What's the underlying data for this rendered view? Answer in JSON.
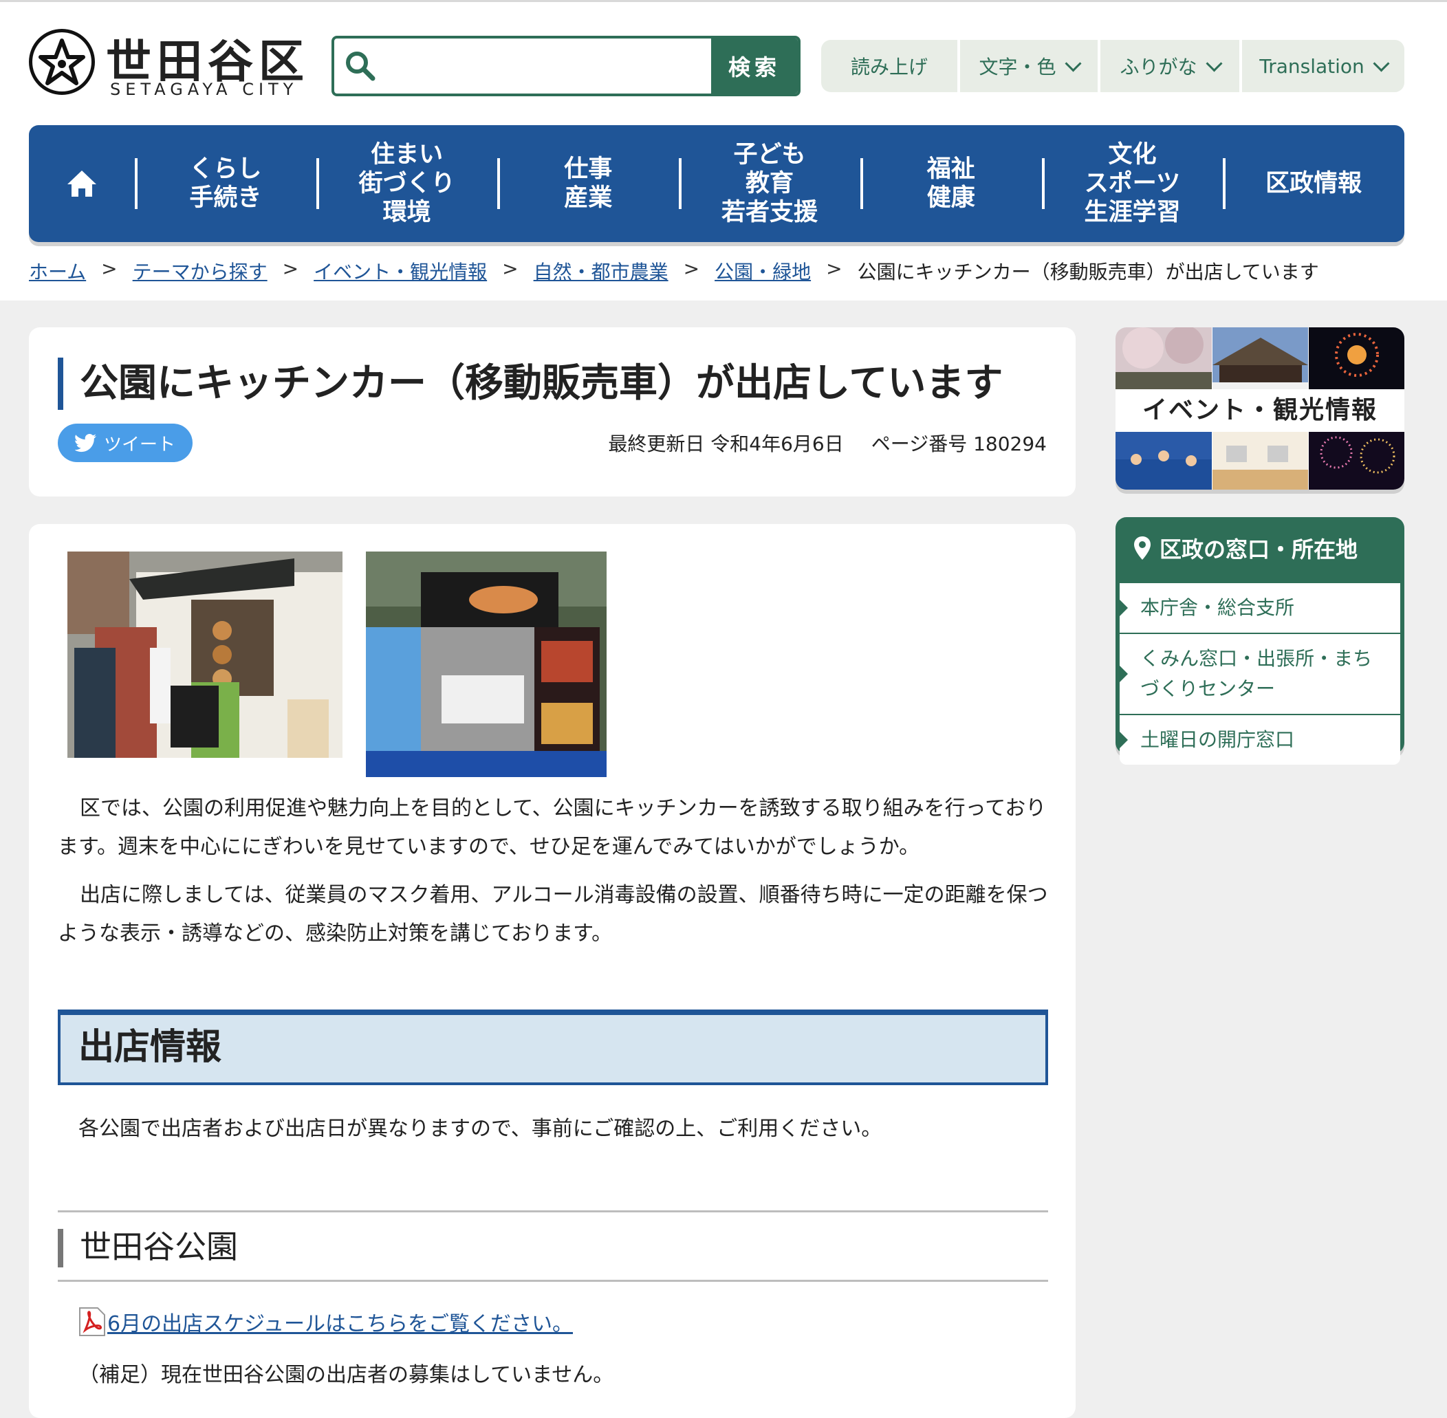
{
  "header": {
    "logo_title": "世田谷区",
    "logo_sub": "SETAGAYA CITY",
    "search_placeholder": "",
    "search_button": "検索",
    "util": [
      "読み上げ",
      "文字・色",
      "ふりがな",
      "Translation"
    ]
  },
  "nav": {
    "home_icon": "home-icon",
    "items": [
      "くらし\n手続き",
      "住まい\n街づくり\n環境",
      "仕事\n産業",
      "子ども\n教育\n若者支援",
      "福祉\n健康",
      "文化\nスポーツ\n生涯学習",
      "区政情報"
    ]
  },
  "breadcrumb": {
    "items": [
      "ホーム",
      "テーマから探す",
      "イベント・観光情報",
      "自然・都市農業",
      "公園・緑地"
    ],
    "current": "公園にキッチンカー（移動販売車）が出店しています",
    "separator": ">"
  },
  "page": {
    "title": "公園にキッチンカー（移動販売車）が出店しています",
    "tweet": "ツイート",
    "updated": "最終更新日 令和4年6月6日",
    "page_number": "ページ番号 180294"
  },
  "content": {
    "para1": "区では、公園の利用促進や魅力向上を目的として、公園にキッチンカーを誘致する取り組みを行っております。週末を中心ににぎわいを見せていますので、せひ足を運んでみてはいかがでしょうか。",
    "para2": "出店に際しましては、従業員のマスク着用、アルコール消毒設備の設置、順番待ち時に一定の距離を保つような表示・誘導などの、感染防止対策を講じております。",
    "h2": "出店情報",
    "para3": "各公園で出店者および出店日が異なりますので、事前にご確認の上、ご利用ください。",
    "h3": "世田谷公園",
    "pdf_link": "6月の出店スケジュールはこちらをご覧ください。",
    "para4": "（補足）現在世田谷公園の出店者の募集はしていません。"
  },
  "sidebar": {
    "banner_text": "イベント・観光情報",
    "office_title": "区政の窓口・所在地",
    "office_items": [
      "本庁舎・総合支所",
      "くみん窓口・出張所・まちづくりセンター",
      "土曜日の開庁窓口"
    ]
  },
  "colors": {
    "nav_blue": "#1f5597",
    "brand_green": "#2e6e57",
    "h2_bg": "#d6e5f0",
    "tweet_blue": "#4a9de8"
  }
}
